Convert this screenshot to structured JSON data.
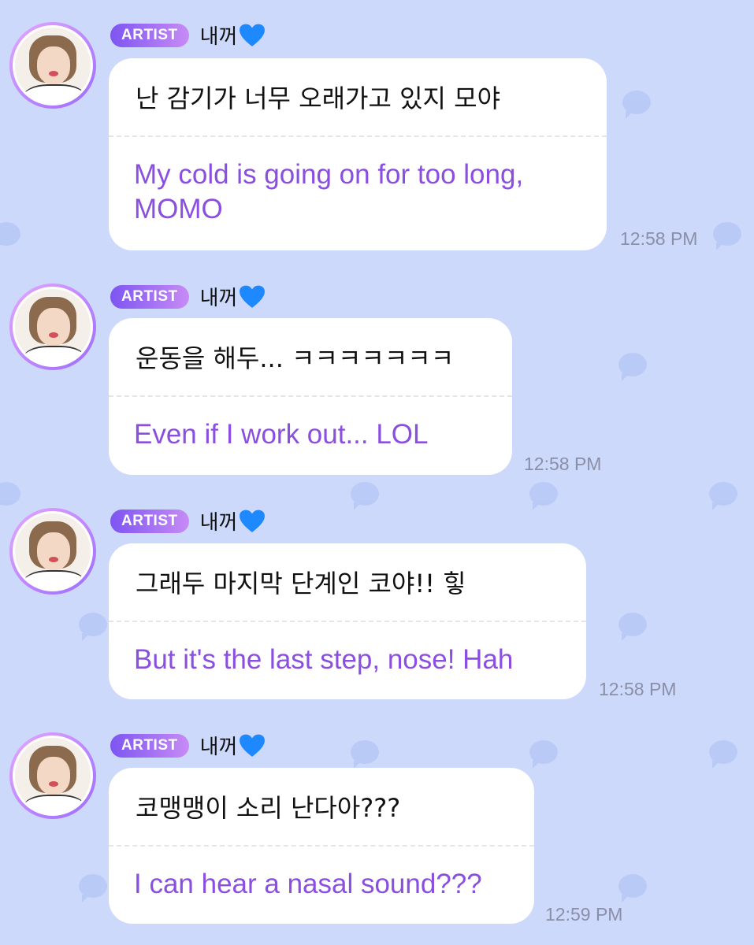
{
  "messages": [
    {
      "badge": "ARTIST",
      "username": "내꺼",
      "korean": "난 감기가 너무 오래가고 있지 모야",
      "english": "My cold is going on for too long, MOMO",
      "time": "12:58 PM"
    },
    {
      "badge": "ARTIST",
      "username": "내꺼",
      "korean": "운동을 해두... ㅋㅋㅋㅋㅋㅋㅋ",
      "english": "Even if I work out... LOL",
      "time": "12:58 PM"
    },
    {
      "badge": "ARTIST",
      "username": "내꺼",
      "korean": "그래두 마지막 단계인 코야!! 힣",
      "english": "But it's the last step, nose! Hah",
      "time": "12:58 PM"
    },
    {
      "badge": "ARTIST",
      "username": "내꺼",
      "korean": "코맹맹이 소리 난다아???",
      "english": "I can hear a nasal sound???",
      "time": "12:59 PM"
    }
  ],
  "colors": {
    "background": "#cdd9fb",
    "translation_text": "#8a4fe0",
    "badge_gradient_start": "#7d55f2",
    "badge_gradient_end": "#c78bf5",
    "heart": "#1e88ff"
  },
  "icons": {
    "username_suffix": "blue-heart-icon",
    "background_pattern": "chat-bubble-icon"
  }
}
